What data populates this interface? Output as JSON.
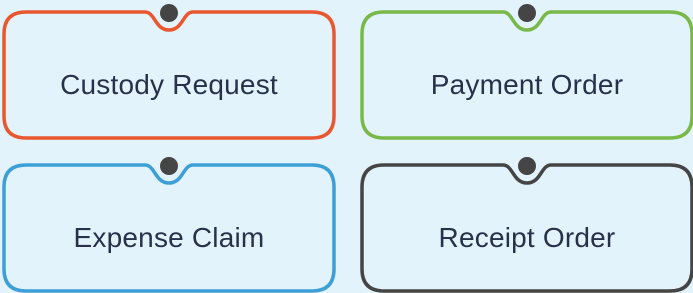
{
  "cards": [
    {
      "label": "Custody Request",
      "color": "#e8572f"
    },
    {
      "label": "Payment Order",
      "color": "#79b94a"
    },
    {
      "label": "Expense Claim",
      "color": "#3d9fd6"
    },
    {
      "label": "Receipt Order",
      "color": "#454545"
    }
  ],
  "dot_color": "#454545"
}
